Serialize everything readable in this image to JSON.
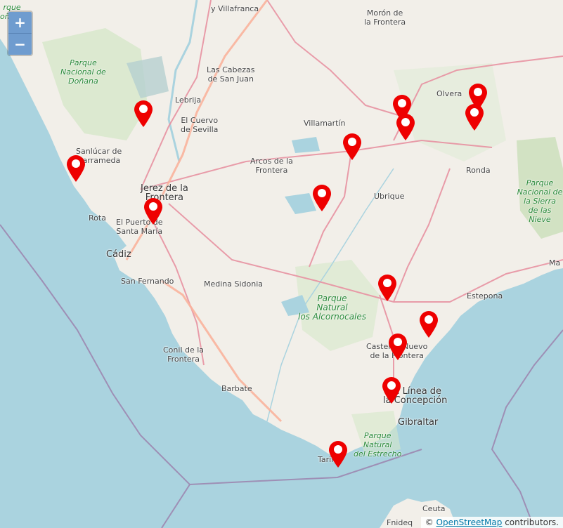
{
  "zoom": {
    "in_label": "+",
    "out_label": "−"
  },
  "attribution": {
    "prefix": "©",
    "link_text": "OpenStreetMap",
    "suffix": " contributors."
  },
  "marker_color": "#ee0000",
  "labels": [
    {
      "name": "label-villafranca",
      "text": "y Villafranca"
    },
    {
      "name": "label-moron",
      "text": "Morón de\nla Frontera"
    },
    {
      "name": "label-donana-top",
      "text": "rque\noñana"
    },
    {
      "name": "label-parque-donana",
      "text": "Parque\nNacional de\nDoñana"
    },
    {
      "name": "label-las-cabezas",
      "text": "Las Cabezas\nde San Juan"
    },
    {
      "name": "label-lebrija",
      "text": "Lebrija"
    },
    {
      "name": "label-el-cuervo",
      "text": "El Cuervo\nde Sevilla"
    },
    {
      "name": "label-olvera",
      "text": "Olvera"
    },
    {
      "name": "label-villamartin",
      "text": "Villamartín"
    },
    {
      "name": "label-sanlucar",
      "text": "Sanlúcar de\nBarrameda"
    },
    {
      "name": "label-arcos",
      "text": "Arcos de la\nFrontera"
    },
    {
      "name": "label-ronda",
      "text": "Ronda"
    },
    {
      "name": "label-jerez",
      "text": "Jerez de la\nFrontera"
    },
    {
      "name": "label-ubrique",
      "text": "Ubrique"
    },
    {
      "name": "label-sierra-nieves",
      "text": "Parque\nNacional de\nla Sierra\nde las Nieve"
    },
    {
      "name": "label-rota",
      "text": "Rota"
    },
    {
      "name": "label-el-puerto",
      "text": "El Puerto de\nSanta María"
    },
    {
      "name": "label-cadiz",
      "text": "Cádiz"
    },
    {
      "name": "label-marbella",
      "text": "Ma"
    },
    {
      "name": "label-san-fernando",
      "text": "San Fernando"
    },
    {
      "name": "label-medina",
      "text": "Medina Sidonia"
    },
    {
      "name": "label-estepona",
      "text": "Estepona"
    },
    {
      "name": "label-alcornocales",
      "text": "Parque\nNatural\nlos Alcornocales"
    },
    {
      "name": "label-castellar",
      "text": "Castellar Nuevo\nde la Frontera"
    },
    {
      "name": "label-conil",
      "text": "Conil de la\nFrontera"
    },
    {
      "name": "label-barbate",
      "text": "Barbate"
    },
    {
      "name": "label-la-linea",
      "text": "La Línea de\nla Concepción"
    },
    {
      "name": "label-gibraltar",
      "text": "Gibraltar"
    },
    {
      "name": "label-estrecho",
      "text": "Parque\nNatural\ndel Estrecho"
    },
    {
      "name": "label-tarifa",
      "text": "Tarifa"
    },
    {
      "name": "label-ceuta",
      "text": "Ceuta"
    },
    {
      "name": "label-fnideq",
      "text": "Fnideq"
    }
  ]
}
